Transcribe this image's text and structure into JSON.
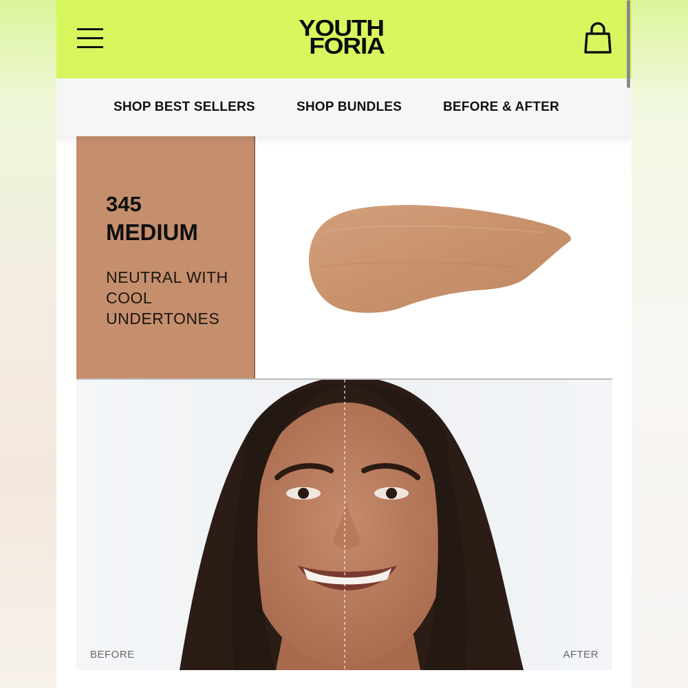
{
  "colors": {
    "accent": "#d8f75e",
    "shade_card": "#c58f6d",
    "swatch": "#c99571"
  },
  "header": {
    "menu_icon": "hamburger-menu-icon",
    "logo_line1": "YOUTH",
    "logo_line2": "FORIA",
    "cart_icon": "shopping-bag-icon"
  },
  "nav": {
    "items": [
      {
        "label": "SHOP BEST SELLERS"
      },
      {
        "label": "SHOP BUNDLES"
      },
      {
        "label": "BEFORE & AFTER"
      }
    ]
  },
  "shade": {
    "number": "345",
    "name": "MEDIUM",
    "description": "NEUTRAL WITH COOL UNDERTONES"
  },
  "photo": {
    "before_label": "BEFORE",
    "after_label": "AFTER"
  }
}
